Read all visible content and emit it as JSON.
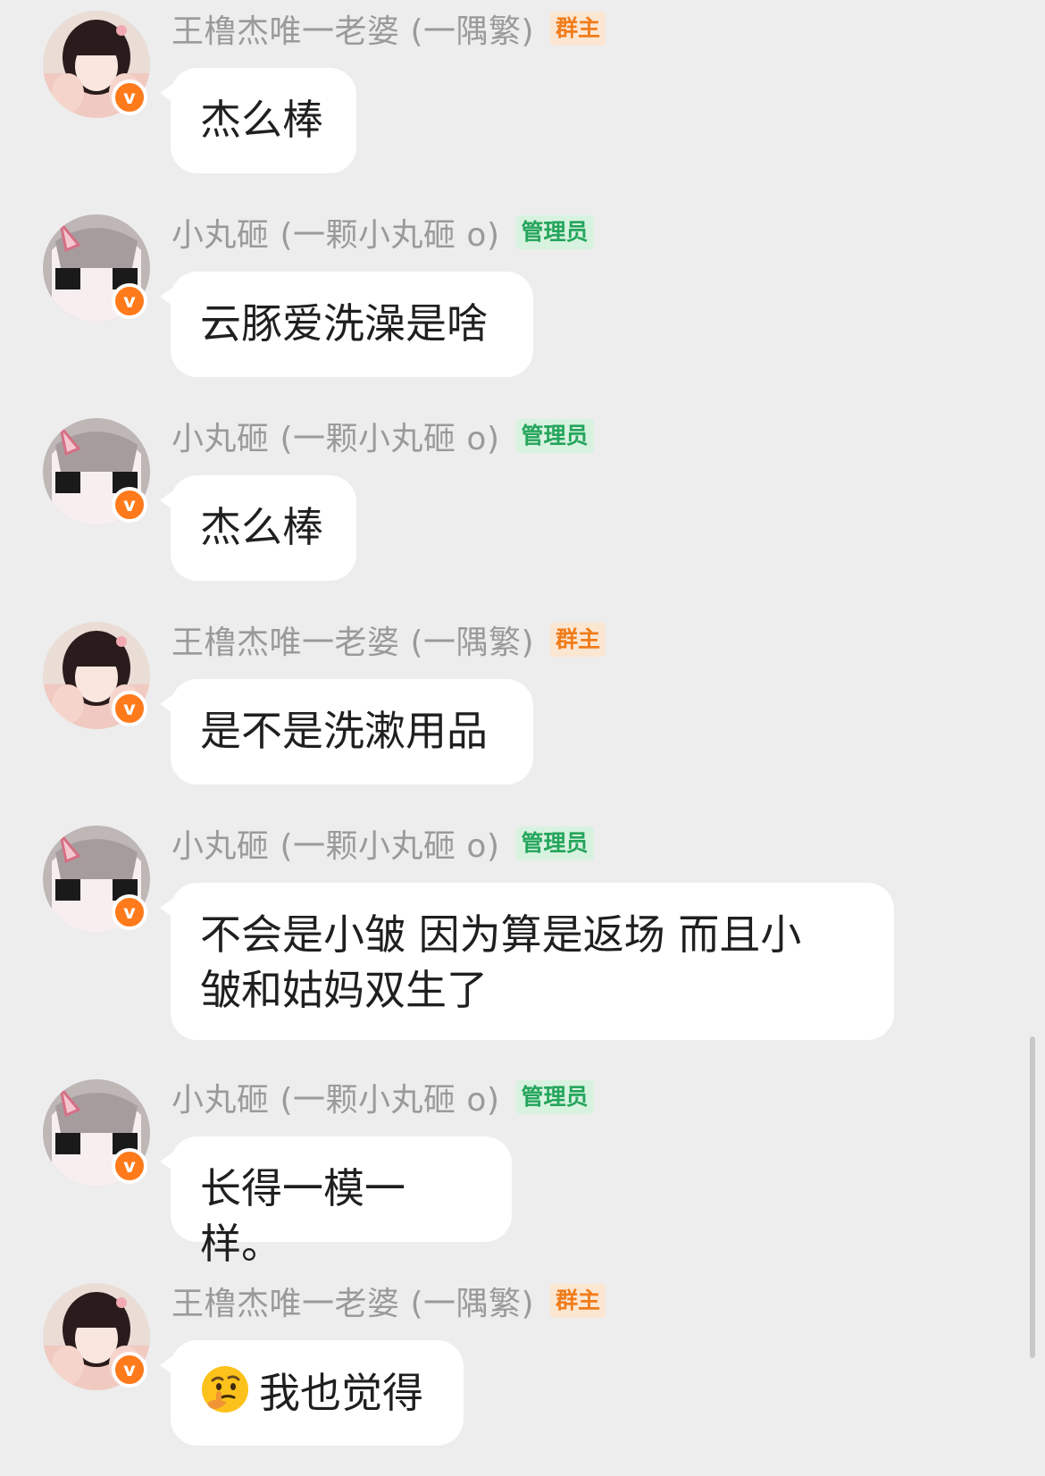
{
  "roles": {
    "owner": "群主",
    "admin": "管理员"
  },
  "badge_letter": "v",
  "colors": {
    "background": "#ededed",
    "bubble": "#ffffff",
    "nickname": "#9a9a9a",
    "owner_tag_bg": "#fbe6d2",
    "owner_tag_text": "#f07c1a",
    "admin_tag_bg": "#d8f2e0",
    "admin_tag_text": "#25a55c",
    "verified_badge": "#ff7a1a"
  },
  "messages": [
    {
      "sender": "王橹杰唯一老婆 (一隅繁)",
      "role": "群主",
      "avatar": "girl-photo-avatar",
      "text": "杰么棒"
    },
    {
      "sender": "小丸砸 (一颗小丸砸 o)",
      "role": "管理员",
      "avatar": "anime-girl-avatar",
      "text": "云豚爱洗澡是啥"
    },
    {
      "sender": "小丸砸 (一颗小丸砸 o)",
      "role": "管理员",
      "avatar": "anime-girl-avatar",
      "text": "杰么棒"
    },
    {
      "sender": "王橹杰唯一老婆 (一隅繁)",
      "role": "群主",
      "avatar": "girl-photo-avatar",
      "text": "是不是洗漱用品"
    },
    {
      "sender": "小丸砸 (一颗小丸砸 o)",
      "role": "管理员",
      "avatar": "anime-girl-avatar",
      "text_line1": "不会是小皱 因为算是返场 而且小",
      "text_line2": "皱和姑妈双生了"
    },
    {
      "sender": "小丸砸 (一颗小丸砸 o)",
      "role": "管理员",
      "avatar": "anime-girl-avatar",
      "text": "长得一模一样。"
    },
    {
      "sender": "王橹杰唯一老婆 (一隅繁)",
      "role": "群主",
      "avatar": "girl-photo-avatar",
      "emoji": "thinking-face-emoji",
      "text": "我也觉得"
    }
  ]
}
